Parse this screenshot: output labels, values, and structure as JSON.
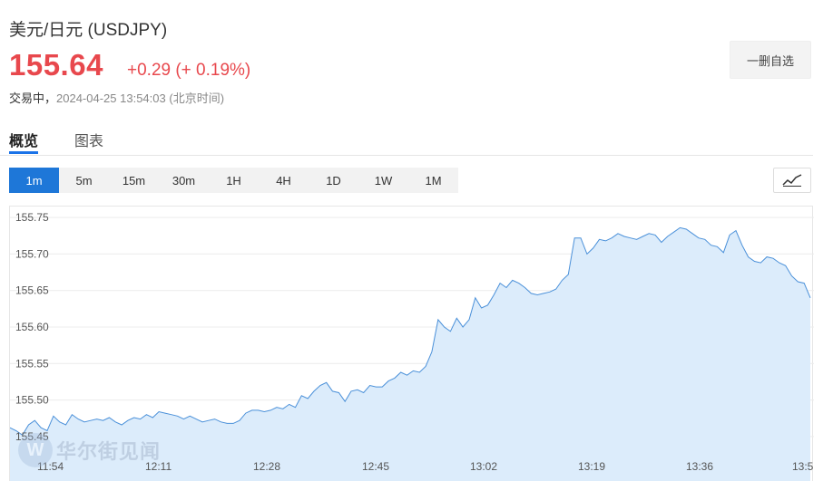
{
  "header": {
    "title": "美元/日元  (USDJPY)",
    "price": "155.64",
    "change": "+0.29 (+ 0.19%)",
    "status_label": "交易中，",
    "timestamp": "2024-04-25 13:54:03",
    "timezone": "(北京时间)",
    "watch_button": "一删自选"
  },
  "tabs": [
    {
      "label": "概览",
      "active": true
    },
    {
      "label": "图表",
      "active": false
    }
  ],
  "periods": [
    {
      "label": "1m",
      "active": true
    },
    {
      "label": "5m",
      "active": false
    },
    {
      "label": "15m",
      "active": false
    },
    {
      "label": "30m",
      "active": false
    },
    {
      "label": "1H",
      "active": false
    },
    {
      "label": "4H",
      "active": false
    },
    {
      "label": "1D",
      "active": false
    },
    {
      "label": "1W",
      "active": false
    },
    {
      "label": "1M",
      "active": false
    }
  ],
  "chart_type_icon": "line-chart-icon",
  "colors": {
    "up": "#e8484d",
    "accent": "#1e77d8",
    "line": "#4a90d9",
    "area": "#dcecfb"
  },
  "watermark": {
    "text": "华尔街见闻"
  },
  "chart_data": {
    "type": "area",
    "y_ticks": [
      "155.75",
      "155.70",
      "155.65",
      "155.60",
      "155.55",
      "155.50",
      "155.45"
    ],
    "x_ticks": [
      "11:54",
      "12:11",
      "12:28",
      "12:45",
      "13:02",
      "13:19",
      "13:36",
      "13:5"
    ],
    "ylim": [
      155.435,
      155.765
    ],
    "grid": true,
    "values": [
      155.462,
      155.458,
      155.452,
      155.466,
      155.472,
      155.462,
      155.458,
      155.478,
      155.47,
      155.466,
      155.48,
      155.474,
      155.47,
      155.472,
      155.474,
      155.472,
      155.476,
      155.47,
      155.466,
      155.472,
      155.476,
      155.474,
      155.48,
      155.476,
      155.484,
      155.482,
      155.48,
      155.478,
      155.474,
      155.478,
      155.474,
      155.47,
      155.472,
      155.474,
      155.47,
      155.468,
      155.468,
      155.472,
      155.482,
      155.486,
      155.486,
      155.484,
      155.486,
      155.49,
      155.488,
      155.494,
      155.49,
      155.506,
      155.502,
      155.512,
      155.52,
      155.524,
      155.512,
      155.51,
      155.498,
      155.512,
      155.514,
      155.51,
      155.52,
      155.518,
      155.518,
      155.526,
      155.53,
      155.538,
      155.534,
      155.54,
      155.538,
      155.546,
      155.566,
      155.61,
      155.6,
      155.594,
      155.612,
      155.6,
      155.61,
      155.64,
      155.626,
      155.63,
      155.644,
      155.66,
      155.654,
      155.664,
      155.66,
      155.654,
      155.646,
      155.644,
      155.646,
      155.648,
      155.652,
      155.664,
      155.672,
      155.722,
      155.722,
      155.7,
      155.708,
      155.72,
      155.718,
      155.722,
      155.728,
      155.724,
      155.722,
      155.72,
      155.724,
      155.728,
      155.726,
      155.716,
      155.724,
      155.73,
      155.736,
      155.734,
      155.728,
      155.722,
      155.72,
      155.712,
      155.71,
      155.702,
      155.726,
      155.732,
      155.712,
      155.696,
      155.69,
      155.688,
      155.696,
      155.694,
      155.688,
      155.684,
      155.67,
      155.662,
      155.66,
      155.64
    ]
  }
}
